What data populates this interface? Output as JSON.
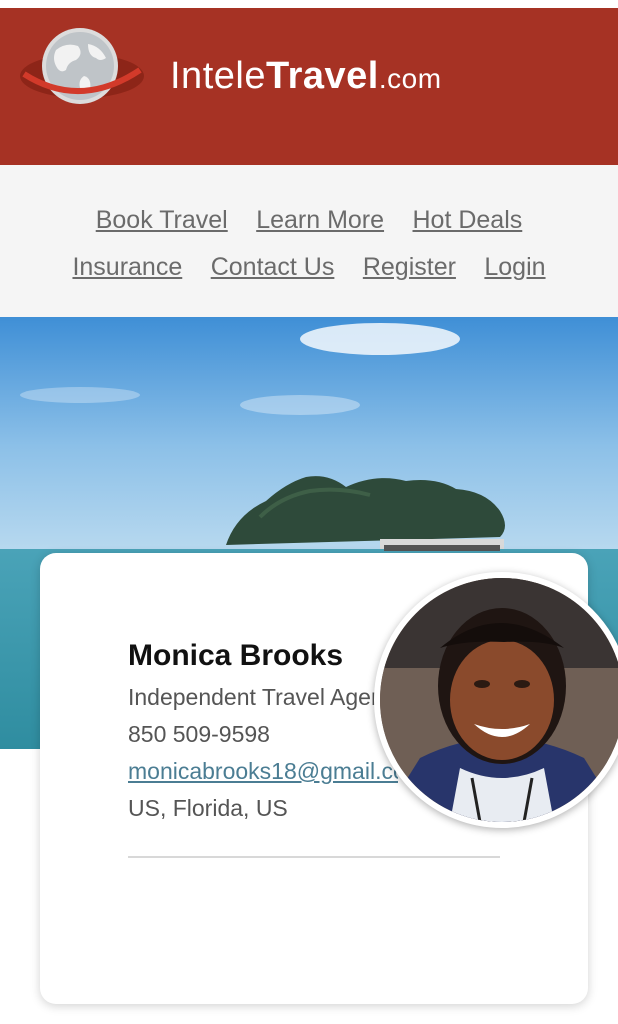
{
  "header": {
    "brand_part1": "Intele",
    "brand_part2": "Travel",
    "brand_part3": ".com"
  },
  "nav": {
    "row1": [
      "Book Travel",
      "Learn More",
      "Hot Deals"
    ],
    "row2": [
      "Insurance",
      "Contact Us",
      "Register",
      "Login"
    ]
  },
  "agent": {
    "name": "Monica Brooks",
    "title": "Independent Travel Agent",
    "phone": "850 509-9598",
    "email": "monicabrooks18@gmail.com",
    "location": "US, Florida, US"
  },
  "colors": {
    "header_red": "#a63224",
    "link_gray": "#6b6b6b",
    "email_blue": "#4b7d93"
  }
}
